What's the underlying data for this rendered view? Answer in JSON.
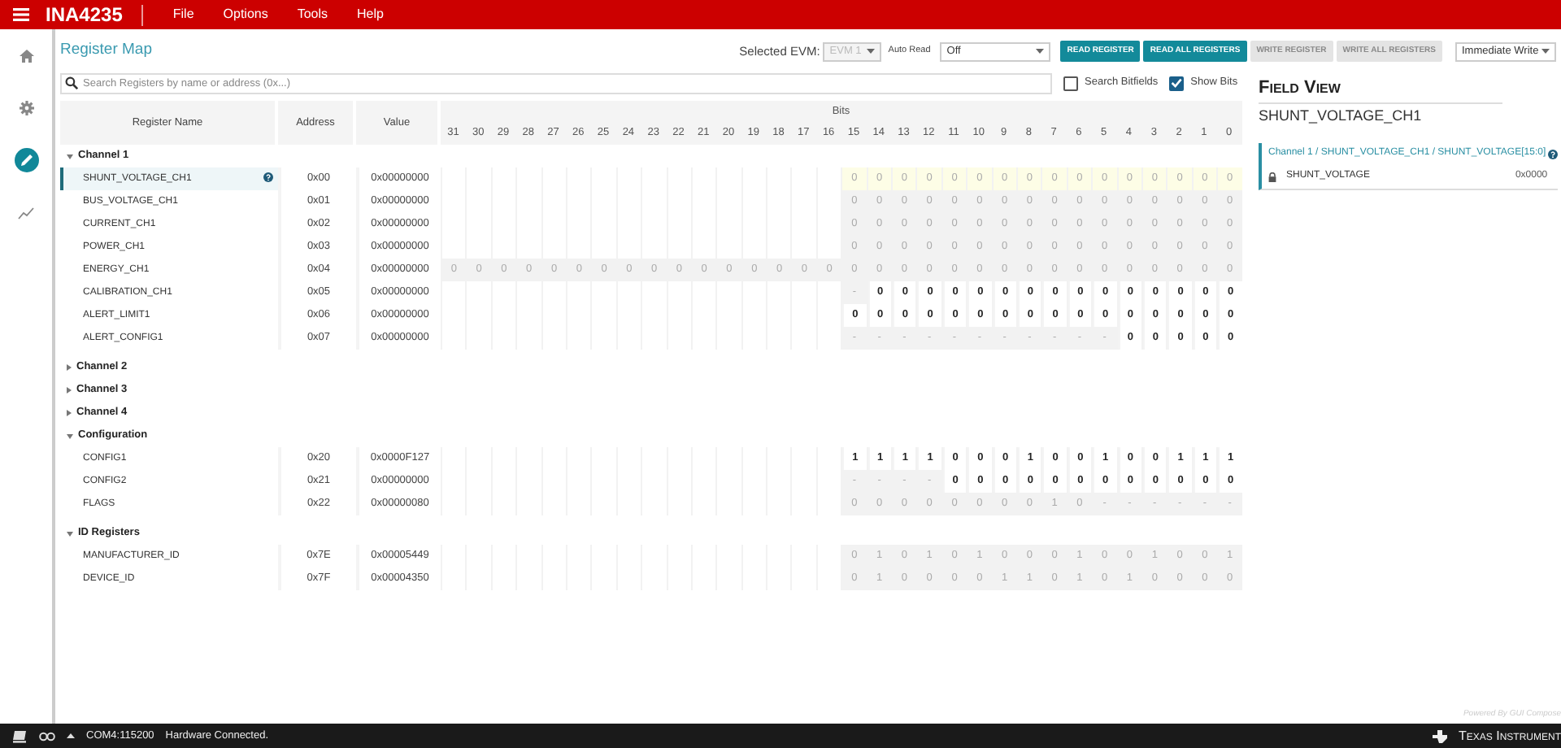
{
  "app": {
    "title": "INA4235",
    "menu": [
      "File",
      "Options",
      "Tools",
      "Help"
    ]
  },
  "nav": [
    {
      "kind": "home",
      "selected": false
    },
    {
      "kind": "settings",
      "selected": false
    },
    {
      "kind": "edit",
      "selected": true
    },
    {
      "kind": "chart",
      "selected": false
    }
  ],
  "toolbar": {
    "title": "Register Map",
    "evm_label": "Selected EVM:",
    "evm_value": "EVM 1",
    "auto_read_label": "Auto Read",
    "auto_read_value": "Off",
    "buttons": [
      {
        "label": "READ REGISTER",
        "disabled": false
      },
      {
        "label": "READ ALL REGISTERS",
        "disabled": false
      },
      {
        "label": "WRITE REGISTER",
        "disabled": true
      },
      {
        "label": "WRITE ALL REGISTERS",
        "disabled": true
      }
    ],
    "write_mode": "Immediate Write"
  },
  "search": {
    "placeholder": "Search Registers by name or address (0x...)"
  },
  "options": [
    {
      "label": "Search Bitfields",
      "checked": false
    },
    {
      "label": "Show Bits",
      "checked": true
    }
  ],
  "table": {
    "columns": [
      "Register Name",
      "Address",
      "Value"
    ],
    "bits_label": "Bits",
    "bit_numbers": [
      "31",
      "30",
      "29",
      "28",
      "27",
      "26",
      "25",
      "24",
      "23",
      "22",
      "21",
      "20",
      "19",
      "18",
      "17",
      "16",
      "15",
      "14",
      "13",
      "12",
      "11",
      "10",
      "9",
      "8",
      "7",
      "6",
      "5",
      "4",
      "3",
      "2",
      "1",
      "0"
    ],
    "groups": [
      {
        "name": "Channel 1",
        "expanded": true,
        "registers": [
          {
            "name": "SHUNT_VOLTAGE_CH1",
            "address": "0x00",
            "value": "0x00000000",
            "selected": true,
            "writable": false,
            "bits": [
              "0",
              "0",
              "0",
              "0",
              "0",
              "0",
              "0",
              "0",
              "0",
              "0",
              "0",
              "0",
              "0",
              "0",
              "0",
              "0"
            ]
          },
          {
            "name": "BUS_VOLTAGE_CH1",
            "address": "0x01",
            "value": "0x00000000",
            "selected": false,
            "writable": false,
            "bits": [
              "0",
              "0",
              "0",
              "0",
              "0",
              "0",
              "0",
              "0",
              "0",
              "0",
              "0",
              "0",
              "0",
              "0",
              "0",
              "0"
            ]
          },
          {
            "name": "CURRENT_CH1",
            "address": "0x02",
            "value": "0x00000000",
            "selected": false,
            "writable": false,
            "bits": [
              "0",
              "0",
              "0",
              "0",
              "0",
              "0",
              "0",
              "0",
              "0",
              "0",
              "0",
              "0",
              "0",
              "0",
              "0",
              "0"
            ]
          },
          {
            "name": "POWER_CH1",
            "address": "0x03",
            "value": "0x00000000",
            "selected": false,
            "writable": false,
            "bits": [
              "0",
              "0",
              "0",
              "0",
              "0",
              "0",
              "0",
              "0",
              "0",
              "0",
              "0",
              "0",
              "0",
              "0",
              "0",
              "0"
            ]
          },
          {
            "name": "ENERGY_CH1",
            "address": "0x04",
            "value": "0x00000000",
            "selected": false,
            "writable": false,
            "bits": [
              "0",
              "0",
              "0",
              "0",
              "0",
              "0",
              "0",
              "0",
              "0",
              "0",
              "0",
              "0",
              "0",
              "0",
              "0",
              "0",
              "0",
              "0",
              "0",
              "0",
              "0",
              "0",
              "0",
              "0",
              "0",
              "0",
              "0",
              "0",
              "0",
              "0",
              "0",
              "0"
            ]
          },
          {
            "name": "CALIBRATION_CH1",
            "address": "0x05",
            "value": "0x00000000",
            "selected": false,
            "writable": true,
            "bits": [
              "-",
              "0",
              "0",
              "0",
              "0",
              "0",
              "0",
              "0",
              "0",
              "0",
              "0",
              "0",
              "0",
              "0",
              "0",
              "0"
            ]
          },
          {
            "name": "ALERT_LIMIT1",
            "address": "0x06",
            "value": "0x00000000",
            "selected": false,
            "writable": true,
            "bits": [
              "0",
              "0",
              "0",
              "0",
              "0",
              "0",
              "0",
              "0",
              "0",
              "0",
              "0",
              "0",
              "0",
              "0",
              "0",
              "0"
            ]
          },
          {
            "name": "ALERT_CONFIG1",
            "address": "0x07",
            "value": "0x00000000",
            "selected": false,
            "writable": true,
            "bits": [
              "-",
              "-",
              "-",
              "-",
              "-",
              "-",
              "-",
              "-",
              "-",
              "-",
              "-",
              "0",
              "0",
              "0",
              "0",
              "0"
            ]
          }
        ]
      },
      {
        "name": "Channel 2",
        "expanded": false
      },
      {
        "name": "Channel 3",
        "expanded": false
      },
      {
        "name": "Channel 4",
        "expanded": false
      },
      {
        "name": "Configuration",
        "expanded": true,
        "registers": [
          {
            "name": "CONFIG1",
            "address": "0x20",
            "value": "0x0000F127",
            "selected": false,
            "writable": true,
            "bits": [
              "1",
              "1",
              "1",
              "1",
              "0",
              "0",
              "0",
              "1",
              "0",
              "0",
              "1",
              "0",
              "0",
              "1",
              "1",
              "1"
            ]
          },
          {
            "name": "CONFIG2",
            "address": "0x21",
            "value": "0x00000000",
            "selected": false,
            "writable": true,
            "bits": [
              "-",
              "-",
              "-",
              "-",
              "0",
              "0",
              "0",
              "0",
              "0",
              "0",
              "0",
              "0",
              "0",
              "0",
              "0",
              "0"
            ]
          },
          {
            "name": "FLAGS",
            "address": "0x22",
            "value": "0x00000080",
            "selected": false,
            "writable": false,
            "bits": [
              "0",
              "0",
              "0",
              "0",
              "0",
              "0",
              "0",
              "0",
              "1",
              "0",
              "-",
              "-",
              "-",
              "-",
              "-",
              "-"
            ]
          }
        ]
      },
      {
        "name": "ID Registers",
        "expanded": true,
        "registers": [
          {
            "name": "MANUFACTURER_ID",
            "address": "0x7E",
            "value": "0x00005449",
            "selected": false,
            "writable": false,
            "bits": [
              "0",
              "1",
              "0",
              "1",
              "0",
              "1",
              "0",
              "0",
              "0",
              "1",
              "0",
              "0",
              "1",
              "0",
              "0",
              "1"
            ]
          },
          {
            "name": "DEVICE_ID",
            "address": "0x7F",
            "value": "0x00004350",
            "selected": false,
            "writable": false,
            "bits": [
              "0",
              "1",
              "0",
              "0",
              "0",
              "0",
              "1",
              "1",
              "0",
              "1",
              "0",
              "1",
              "0",
              "0",
              "0",
              "0"
            ]
          }
        ]
      }
    ]
  },
  "field_view": {
    "title": "Field View",
    "register": "SHUNT_VOLTAGE_CH1",
    "path": "Channel 1 / SHUNT_VOLTAGE_CH1 / SHUNT_VOLTAGE[15:0]",
    "fields": [
      {
        "name": "SHUNT_VOLTAGE",
        "value": "0x0000",
        "locked": true
      }
    ]
  },
  "status_bar": {
    "port": "COM4:115200",
    "message": "Hardware Connected.",
    "powered_by": "Powered By GUI Compose",
    "brand": "Texas Instrument"
  }
}
